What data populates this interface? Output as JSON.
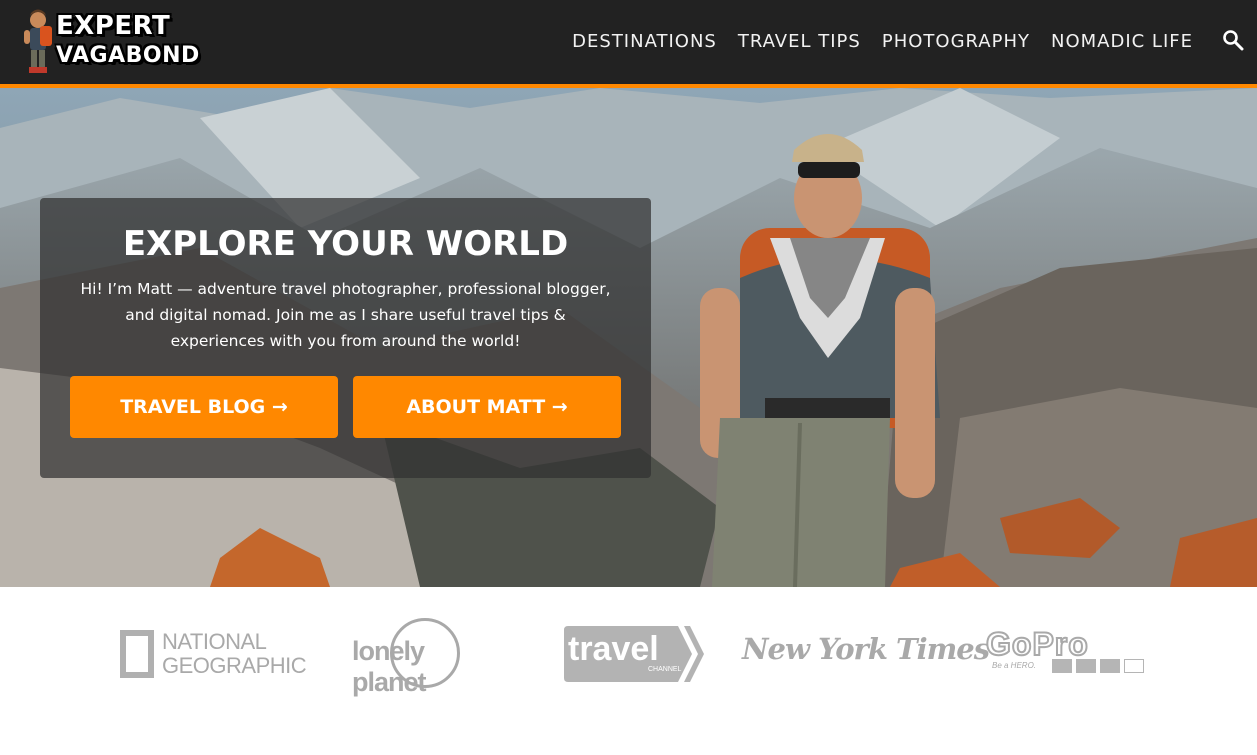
{
  "header": {
    "logo": {
      "line1": "EXPERT",
      "line2": "VAGABOND"
    },
    "nav": [
      {
        "label": "DESTINATIONS"
      },
      {
        "label": "TRAVEL TIPS"
      },
      {
        "label": "PHOTOGRAPHY"
      },
      {
        "label": "NOMADIC LIFE"
      }
    ],
    "search_icon": "search-icon",
    "accent_color": "#ff8800"
  },
  "hero": {
    "title": "EXPLORE YOUR WORLD",
    "text": "Hi! I’m Matt — adventure travel photographer, professional blogger, and digital nomad. Join me as I share useful travel tips & experiences with you from around the world!",
    "buttons": [
      {
        "label": "TRAVEL BLOG →"
      },
      {
        "label": "ABOUT MATT →"
      }
    ],
    "button_color": "#ff8800"
  },
  "press": {
    "national_geographic": {
      "line1": "NATIONAL",
      "line2": "GEOGRAPHIC"
    },
    "lonely_planet": "lonely planet",
    "travel_channel": {
      "main": "travel",
      "sub": "CHANNEL"
    },
    "new_york_times": "New York Times",
    "gopro": {
      "main": "GoPro",
      "sub": "Be a HERO."
    }
  }
}
